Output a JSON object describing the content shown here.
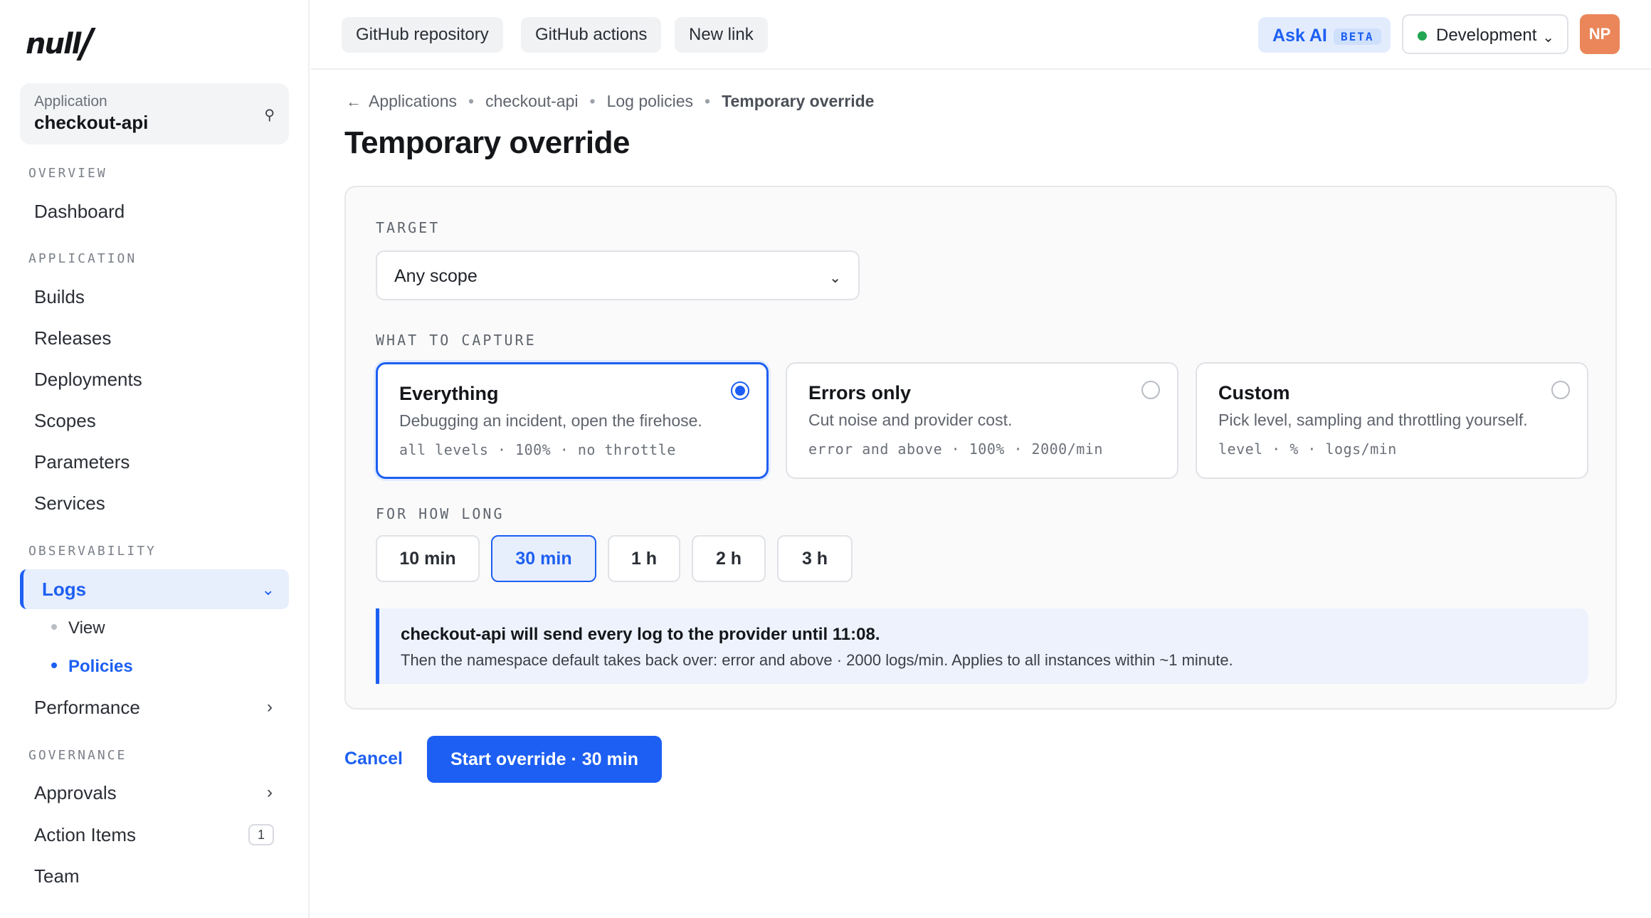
{
  "brand": {
    "logo_text": "null"
  },
  "app_switcher": {
    "label": "Application",
    "name": "checkout-api",
    "icon": "search-icon"
  },
  "sidebar": {
    "sections": {
      "overview": "OVERVIEW",
      "application": "APPLICATION",
      "observability": "OBSERVABILITY",
      "governance": "GOVERNANCE"
    },
    "items": {
      "dashboard": "Dashboard",
      "builds": "Builds",
      "releases": "Releases",
      "deployments": "Deployments",
      "scopes": "Scopes",
      "parameters": "Parameters",
      "services": "Services",
      "logs": "Logs",
      "logs_view": "View",
      "logs_policies": "Policies",
      "performance": "Performance",
      "approvals": "Approvals",
      "action_items": "Action Items",
      "action_items_count": "1",
      "team": "Team"
    }
  },
  "topbar": {
    "links": [
      "GitHub repository",
      "GitHub actions",
      "New link"
    ],
    "ask_ai": "Ask AI",
    "ask_ai_badge": "BETA",
    "environment": "Development",
    "environment_status_color": "#22a653",
    "avatar_initials": "NP"
  },
  "breadcrumb": {
    "back_icon": "arrow-left-icon",
    "items": [
      "Applications",
      "checkout-api",
      "Log policies",
      "Temporary override"
    ]
  },
  "page": {
    "title": "Temporary override",
    "target_label": "TARGET",
    "target_value": "Any scope",
    "capture_label": "WHAT TO CAPTURE",
    "capture_options": [
      {
        "title": "Everything",
        "desc": "Debugging an incident, open the firehose.",
        "meta": "all levels · 100% · no throttle",
        "selected": true
      },
      {
        "title": "Errors only",
        "desc": "Cut noise and provider cost.",
        "meta": "error and above · 100% · 2000/min",
        "selected": false
      },
      {
        "title": "Custom",
        "desc": "Pick level, sampling and throttling yourself.",
        "meta": "level · % · logs/min",
        "selected": false
      }
    ],
    "duration_label": "FOR HOW LONG",
    "durations": [
      "10 min",
      "30 min",
      "1 h",
      "2 h",
      "3 h"
    ],
    "selected_duration": "30 min",
    "notice_title": "checkout-api will send every log to the provider until 11:08.",
    "notice_body": "Then the namespace default takes back over: error and above · 2000 logs/min. Applies to all instances within ~1 minute.",
    "cancel_label": "Cancel",
    "start_label": "Start override · 30 min"
  },
  "colors": {
    "accent": "#1d5ff2",
    "avatar": "#ea8659"
  }
}
